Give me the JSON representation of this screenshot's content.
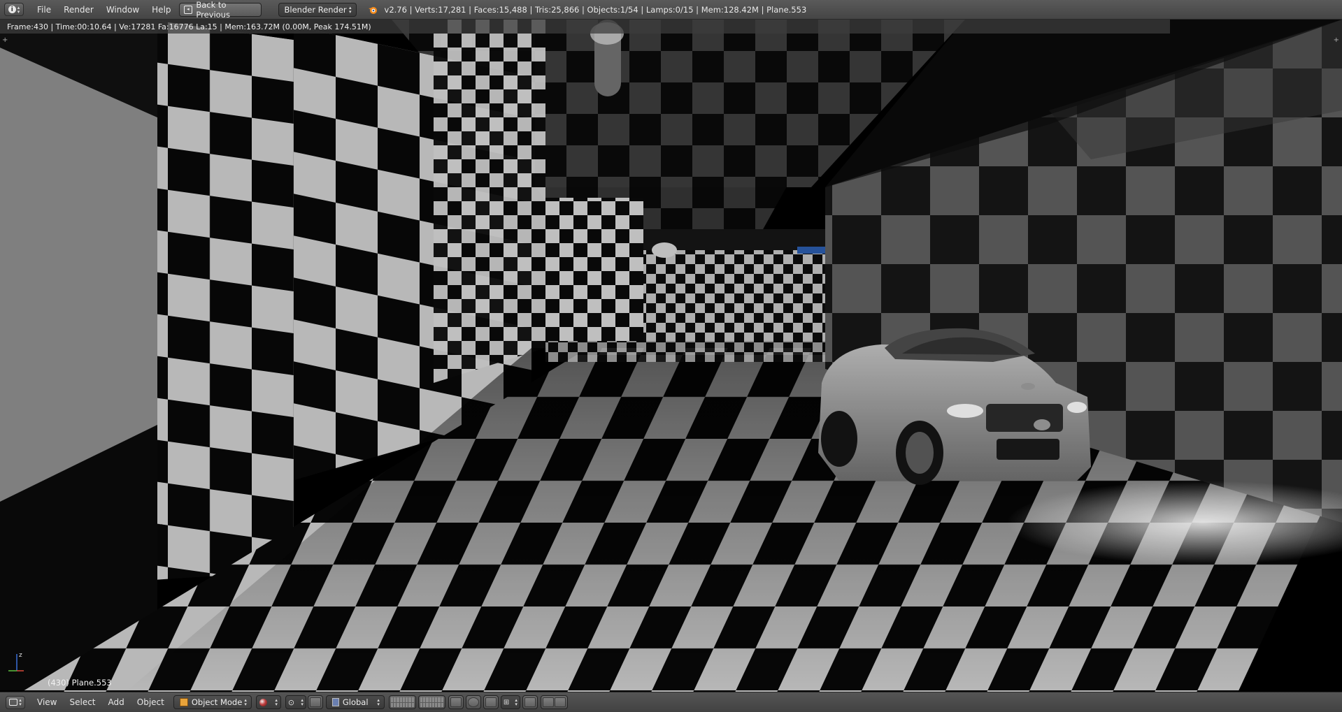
{
  "topbar": {
    "menus": [
      "File",
      "Render",
      "Window",
      "Help"
    ],
    "back_button": "Back to Previous",
    "engine": "Blender Render",
    "stats": "v2.76 | Verts:17,281 | Faces:15,488 | Tris:25,866 | Objects:1/54 | Lamps:0/15 | Mem:128.42M | Plane.553"
  },
  "viewport": {
    "render_info": "Frame:430 | Time:00:10.64 | Ve:17281 Fa:16776 La:15 | Mem:163.72M (0.00M, Peak 174.51M)",
    "object_label": "(430) Plane.553",
    "axis_label": "z"
  },
  "bottombar": {
    "menus": [
      "View",
      "Select",
      "Add",
      "Object"
    ],
    "mode": "Object Mode",
    "orientation": "Global"
  },
  "colors": {
    "header_bg": "#4a4a4a",
    "render_info_bg": "#3c3c3c",
    "checker_light": "#c8c8c8",
    "checker_dark": "#080808",
    "axis_z": "#3b6fd8",
    "axis_x": "#d84b3b",
    "axis_y": "#5fbf3f"
  }
}
